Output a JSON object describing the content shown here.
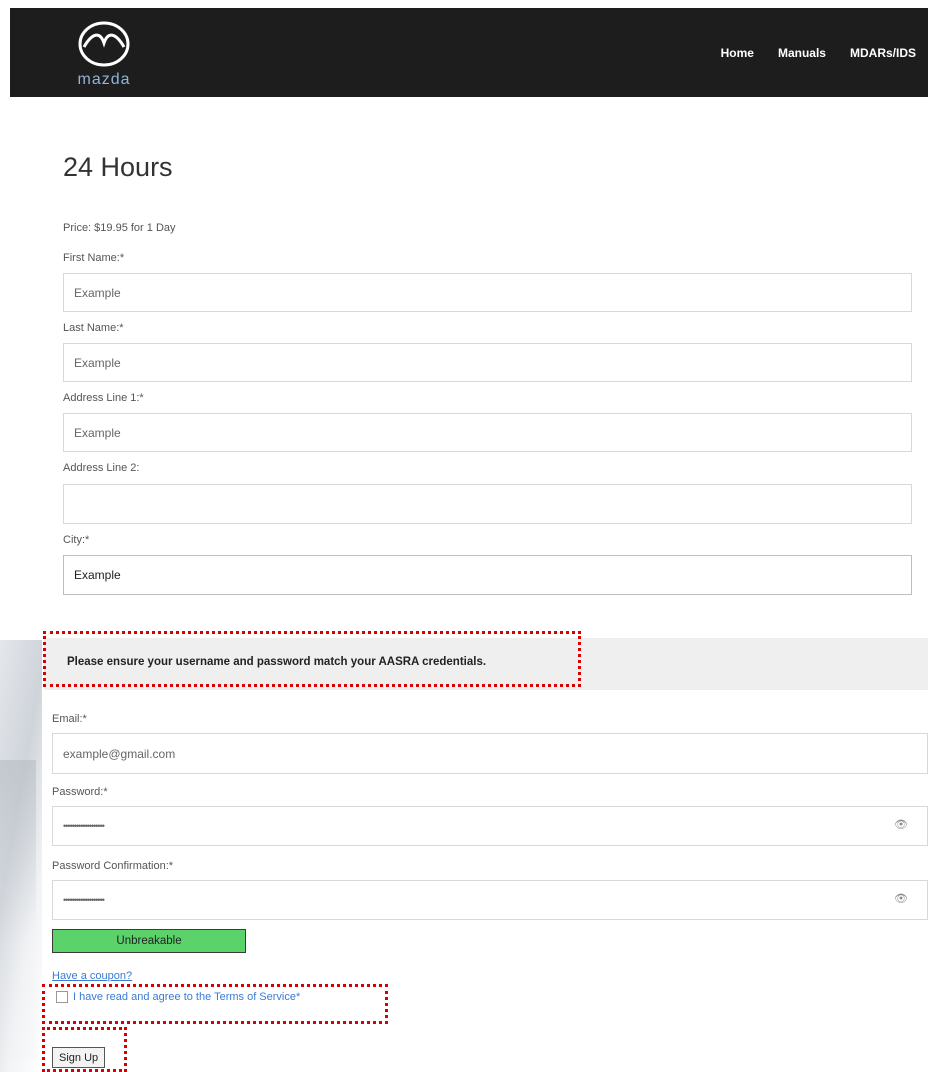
{
  "header": {
    "brand": "mazda",
    "nav": [
      "Home",
      "Manuals",
      "MDARs/IDS"
    ]
  },
  "page": {
    "title": "24 Hours",
    "price": "Price: $19.95 for 1 Day"
  },
  "form": {
    "first_name": {
      "label": "First Name:*",
      "value": "Example"
    },
    "last_name": {
      "label": "Last Name:*",
      "value": "Example"
    },
    "address1": {
      "label": "Address Line 1:*",
      "value": "Example"
    },
    "address2": {
      "label": "Address Line 2:",
      "value": ""
    },
    "city": {
      "label": "City:*",
      "value": "Example"
    },
    "notice": "Please ensure your username and password match your AASRA credentials.",
    "email": {
      "label": "Email:*",
      "value": "example@gmail.com"
    },
    "password": {
      "label": "Password:*",
      "value": "•••••••••••••••••••"
    },
    "password_confirm": {
      "label": "Password Confirmation:*",
      "value": "•••••••••••••••••••"
    },
    "strength": "Unbreakable",
    "coupon": "Have a coupon?",
    "tos": "I have read and agree to the Terms of Service*",
    "submit": "Sign Up"
  },
  "colors": {
    "header_bg": "#1d1d1d",
    "strength": "#5bd36a",
    "highlight": "#d60000",
    "link": "#3a7bd5"
  }
}
